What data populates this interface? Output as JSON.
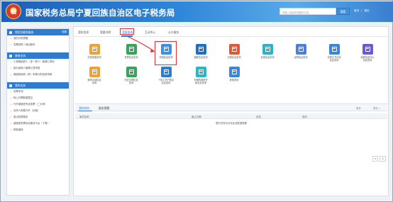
{
  "header": {
    "title": "国家税务总局宁夏回族自治区电子税务局",
    "search_placeholder": "请输入搜索您想要的内容",
    "search_button": "搜索",
    "links": [
      "首页",
      "|",
      "退出"
    ]
  },
  "sidebar": {
    "sections": [
      {
        "title": "常用功能和服务",
        "more": "设置",
        "items": [
          "我的办税提醒",
          "发票领购 / 验旧服务"
        ]
      },
      {
        "title": "套餐业务",
        "items": [
          "小规模纳税人（非一般人）套餐汇算标",
          "新办纳税人套餐汇算申报",
          "增值税纳税（附）申报与附加税申报"
        ]
      },
      {
        "title": "我的业务",
        "items": [
          "发票申领",
          "网上开票数据提交",
          "代开增值税专用发票（二手房）",
          "自然人房屋代开（出租）",
          "重点税源报告",
          "增值税发票综合服务平台（下载）",
          "税款缴纳"
        ]
      }
    ]
  },
  "main": {
    "tabs": [
      "我的信息",
      "我要办税",
      "我要查询",
      "互动中心",
      "公众服务"
    ],
    "active_tab": "我要查询",
    "items_row1": [
      "办税进度查询",
      "发票信息查询",
      "申报信息查询",
      "缴款信息查询",
      "欠税信息查询",
      "优惠信息查询",
      "证明信息查询",
      "涉税文书办结\n信息查询",
      "纳税信用评价\n信息查询"
    ],
    "items_row2": [
      "继承手续信息\n查询",
      "历史办理信息\n查询",
      "个体工商户核定\n信息查询",
      "车辆购置税完\n税信息查询",
      "其他查询"
    ],
    "bottom_tabs": [
      "我的待办",
      "服务提醒"
    ],
    "bottom_more_left": "更多",
    "bottom_more_right": "更多 »",
    "columns": [
      "事项名称",
      "截止日期",
      "状态",
      "操作"
    ],
    "empty_text": "暂时没有待办信息或数据需要",
    "pager": [
      "<",
      "1"
    ]
  },
  "colors": {
    "header": "#2f86d8",
    "accent": "#2e7bd0",
    "highlight": "#e0303a",
    "tiles": [
      "#e8a33b",
      "#3aa35a",
      "#3e8fdc",
      "#1f6fc4",
      "#e05a3a",
      "#2bb4c4",
      "#4d7fd6",
      "#3b86d8",
      "#6b5bd0",
      "#e8a33b",
      "#3aa35a",
      "#2e7bd0",
      "#2bb4c4",
      "#3b86d8"
    ]
  }
}
